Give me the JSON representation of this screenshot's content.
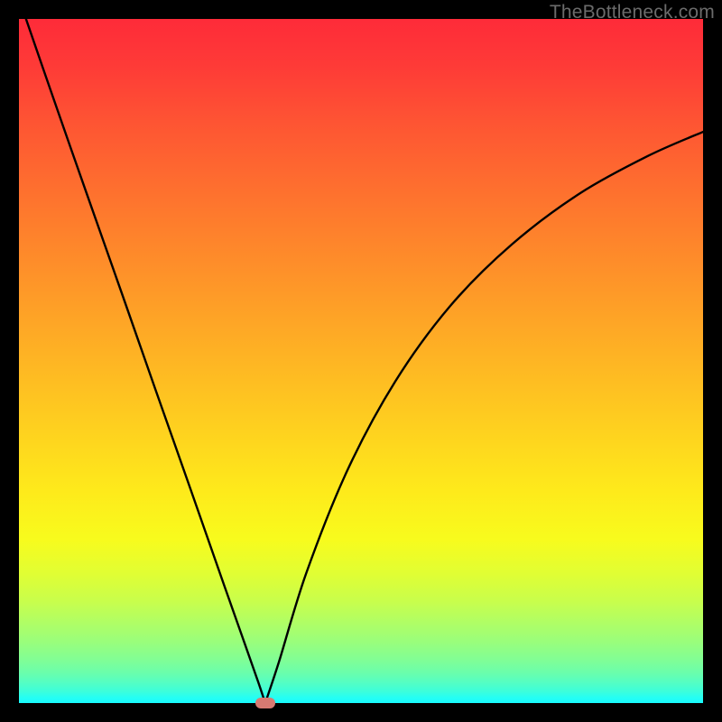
{
  "watermark": "TheBottleneck.com",
  "colors": {
    "background": "#000000",
    "marker": "#d77a72",
    "curve": "#000000"
  },
  "chart_data": {
    "type": "line",
    "title": "",
    "xlabel": "",
    "ylabel": "",
    "xlim": [
      0,
      100
    ],
    "ylim": [
      0,
      100
    ],
    "grid": false,
    "legend": false,
    "series": [
      {
        "name": "bottleneck-curve-left",
        "x": [
          0,
          5,
          10,
          15,
          20,
          25,
          30,
          33,
          35,
          36
        ],
        "y": [
          103,
          88.5,
          74.2,
          60.0,
          45.7,
          31.5,
          17.2,
          8.7,
          3.0,
          0
        ]
      },
      {
        "name": "bottleneck-curve-right",
        "x": [
          36,
          38,
          42,
          48,
          55,
          63,
          72,
          82,
          92,
          100
        ],
        "y": [
          0,
          6,
          19,
          34,
          47,
          58,
          67,
          74.5,
          80,
          83.5
        ]
      }
    ],
    "marker": {
      "x": 36,
      "y": 0
    },
    "gradient_stops": [
      {
        "pos": 0,
        "color": "#fe2b39"
      },
      {
        "pos": 50,
        "color": "#feb823"
      },
      {
        "pos": 76,
        "color": "#f8fb1d"
      },
      {
        "pos": 100,
        "color": "#18fbfe"
      }
    ]
  }
}
